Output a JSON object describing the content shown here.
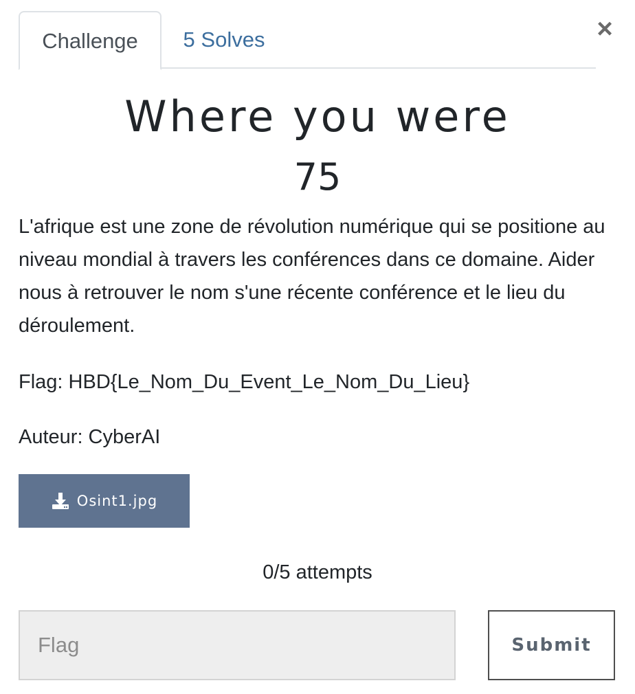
{
  "tabs": {
    "challenge_label": "Challenge",
    "solves_label": "5 Solves"
  },
  "close_glyph": "×",
  "challenge": {
    "title": "Where you were",
    "points": "75",
    "description": "L'afrique est une zone de révolution numérique qui se positione au niveau mondial à travers les conférences dans ce domaine. Aider nous à retrouver le nom s'une récente conférence et le lieu du déroulement.",
    "flag_format": "Flag: HBD{Le_Nom_Du_Event_Le_Nom_Du_Lieu}",
    "author": "Auteur: CyberAI"
  },
  "file": {
    "name": "Osint1.jpg",
    "icon": "download-icon"
  },
  "attempts": "0/5 attempts",
  "form": {
    "flag_placeholder": "Flag",
    "flag_value": "",
    "submit_label": "Submit"
  },
  "colors": {
    "link": "#3c6e9e",
    "file_button_bg": "#5f7390",
    "input_bg": "#eeeeee"
  }
}
